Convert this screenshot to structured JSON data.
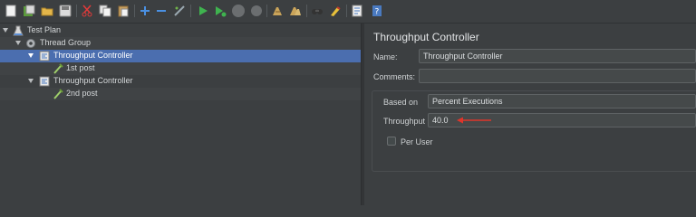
{
  "toolbar": {
    "icons": [
      "new-icon",
      "templates-icon",
      "open-icon",
      "save-icon",
      "cut-icon",
      "copy-icon",
      "paste-icon",
      "expand-icon",
      "collapse-icon",
      "toggle-icon",
      "start-icon",
      "start-no-pauses-icon",
      "stop-icon",
      "shutdown-icon",
      "clear-icon",
      "clear-all-icon",
      "search-icon",
      "reset-search-icon",
      "function-helper-icon",
      "help-icon"
    ]
  },
  "tree": {
    "items": [
      {
        "label": "Test Plan",
        "icon": "flask-icon",
        "expanded": true
      },
      {
        "label": "Thread Group",
        "icon": "gear-icon",
        "expanded": true
      },
      {
        "label": "Throughput Controller",
        "icon": "controller-icon",
        "expanded": true,
        "selected": true
      },
      {
        "label": "1st post",
        "icon": "pipette-icon"
      },
      {
        "label": "Throughput Controller",
        "icon": "controller-icon",
        "expanded": true
      },
      {
        "label": "2nd post",
        "icon": "pipette-icon"
      }
    ]
  },
  "panel": {
    "title": "Throughput Controller",
    "name_label": "Name:",
    "name_value": "Throughput Controller",
    "comments_label": "Comments:",
    "comments_value": "",
    "based_on_label": "Based on",
    "based_on_value": "Percent Executions",
    "throughput_label": "Throughput",
    "throughput_value": "40.0",
    "per_user_label": "Per User",
    "per_user_checked": false
  },
  "colors": {
    "selection": "#4b6eaf",
    "annotation_arrow": "#e0352b",
    "background": "#3c3f41"
  }
}
